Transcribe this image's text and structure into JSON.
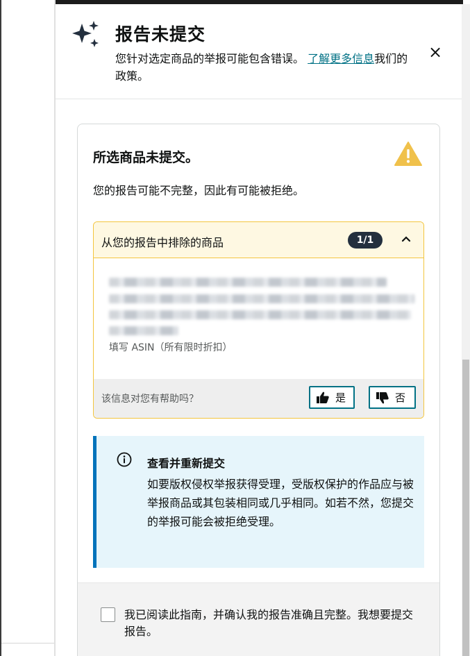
{
  "header": {
    "title": "报告未提交",
    "subtitle_prefix": "您针对选定商品的举报可能包含错误。",
    "learn_more_link": "了解更多信息",
    "subtitle_suffix": "我们的政策。",
    "close_label": "×"
  },
  "card": {
    "title": "所选商品未提交。",
    "description": "您的报告可能不完整，因此有可能被拒绝。"
  },
  "excluded_items": {
    "header_label": "从您的报告中排除的商品",
    "count_badge": "1/1",
    "item_subtext": "填写 ASIN（所有限时折扣）",
    "feedback_question": "该信息对您有帮助吗？",
    "yes_label": "是",
    "no_label": "否"
  },
  "info_box": {
    "title": "查看并重新提交",
    "body": "如要版权侵权举报获得受理，受版权保护的作品应与被举报商品或其包装相同或几乎相同。如若不然，您提交的举报可能会被拒绝受理。"
  },
  "confirm": {
    "checkbox_label": "我已阅读此指南，并确认我的报告准确且完整。我想要提交报告。"
  },
  "colors": {
    "link": "#007185",
    "warning": "#f0c14b",
    "info_accent": "#0073bb",
    "badge": "#232f3e"
  }
}
